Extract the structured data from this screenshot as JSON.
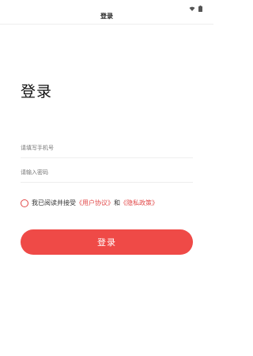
{
  "status_bar": {
    "icons": [
      "wifi-icon",
      "battery-icon"
    ]
  },
  "header": {
    "title": "登录"
  },
  "main": {
    "title": "登录",
    "phone_field": {
      "value": "",
      "placeholder": "请填写手机号"
    },
    "password_field": {
      "value": "",
      "placeholder": "请输入密码"
    },
    "agreement": {
      "checked": false,
      "prefix": "我已阅读并接受",
      "user_agreement": "《用户协议》",
      "conjunction": "和",
      "privacy_policy": "《隐私政策》"
    },
    "login_button": "登录"
  },
  "colors": {
    "accent": "#ef4a47",
    "link": "#e24a4a"
  }
}
